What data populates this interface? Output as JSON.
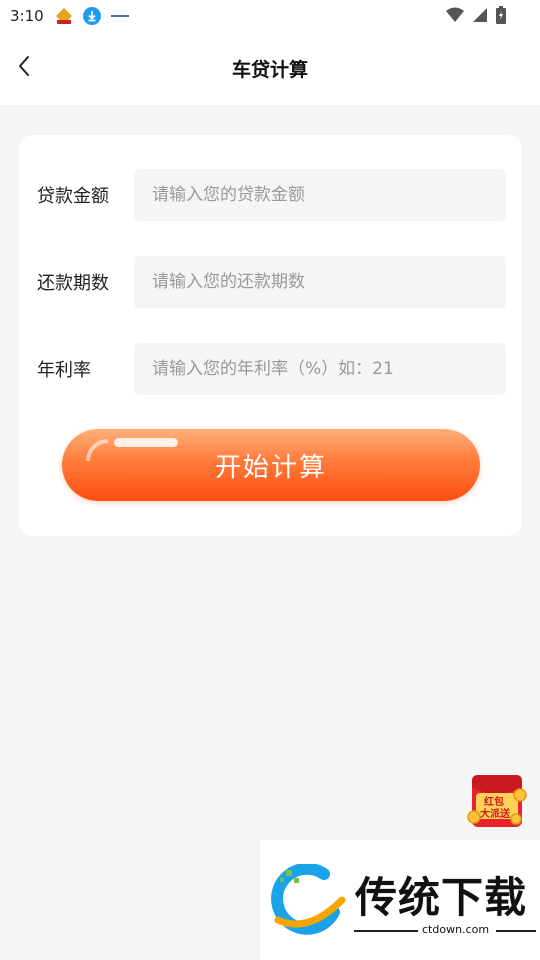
{
  "status_bar": {
    "time": "3:10",
    "icons": [
      "app-badge-icon",
      "download-icon",
      "app-small-icon",
      "wifi-icon",
      "signal-icon",
      "battery-icon"
    ]
  },
  "header": {
    "title": "车贷计算",
    "back_icon": "chevron-left-icon"
  },
  "form": {
    "amount": {
      "label": "贷款金额",
      "placeholder": "请输入您的贷款金额",
      "value": ""
    },
    "periods": {
      "label": "还款期数",
      "placeholder": "请输入您的还款期数",
      "value": ""
    },
    "rate": {
      "label": "年利率",
      "placeholder": "请输入您的年利率（%）如：21",
      "value": ""
    },
    "submit_label": "开始计算"
  },
  "float_promo": {
    "line1": "红包",
    "line2": "大派送",
    "accent": "#e8242a"
  },
  "watermark": {
    "brand": "传统下载",
    "url": "ctdown.com"
  },
  "colors": {
    "accent_orange": "#ff5a1a",
    "page_bg": "#f5f5f5",
    "card_bg": "#ffffff"
  }
}
